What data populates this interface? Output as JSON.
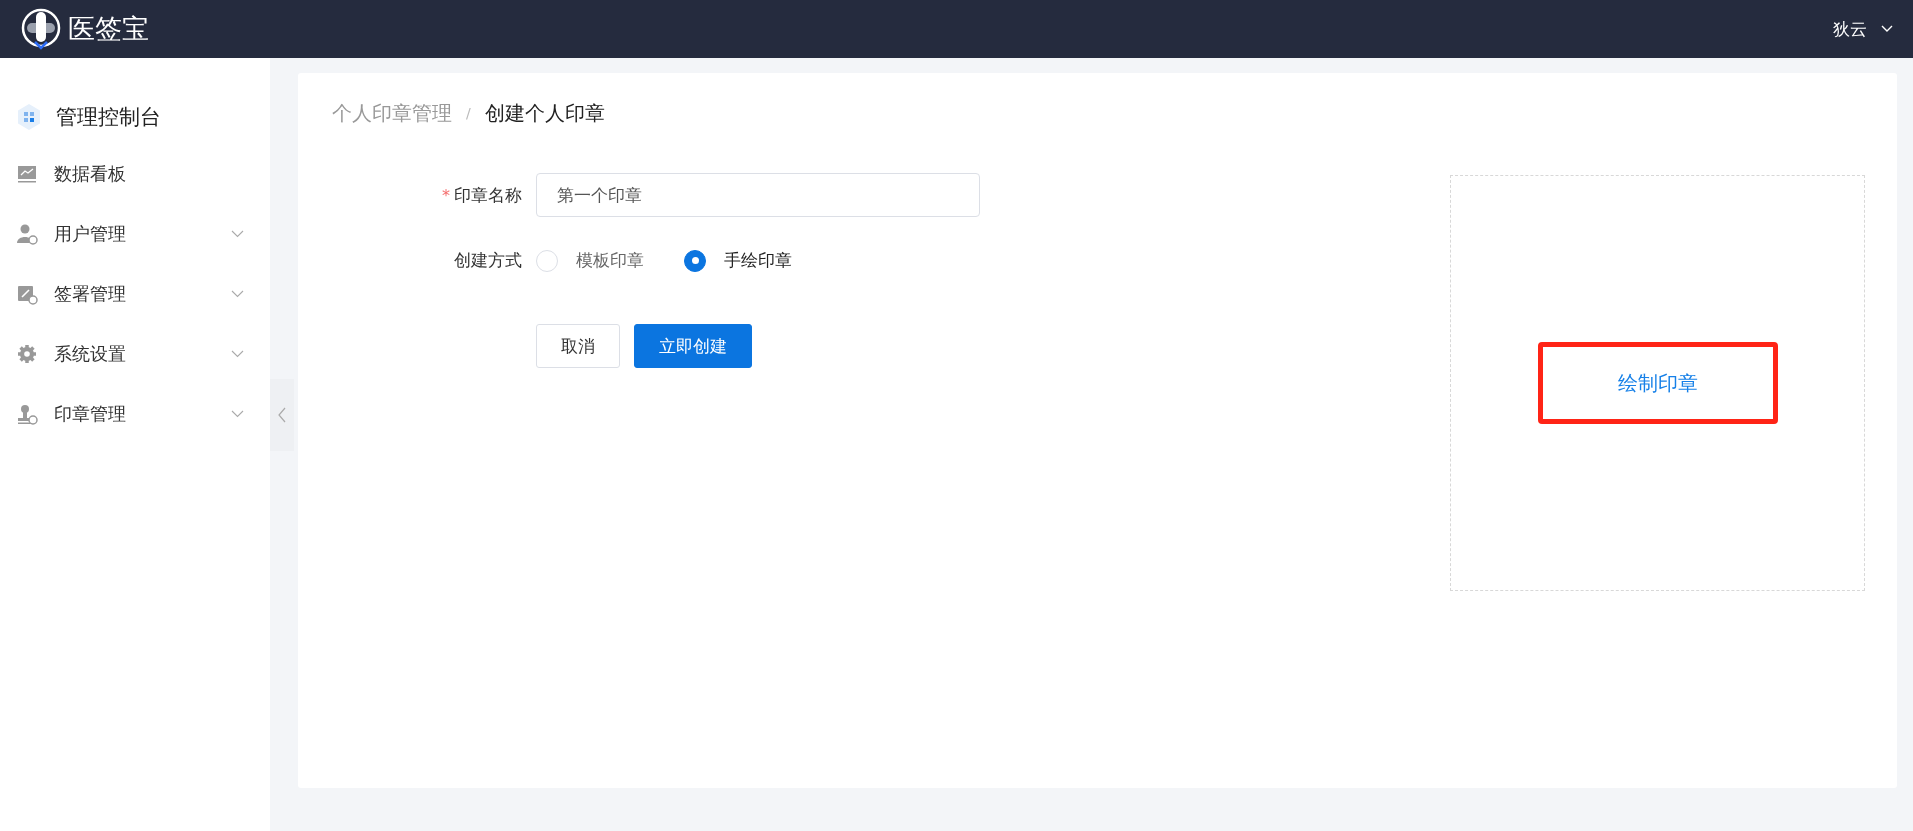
{
  "header": {
    "logo_text": "医签宝",
    "user": "狄云"
  },
  "sidebar": {
    "title": "管理控制台",
    "items": [
      {
        "label": "数据看板",
        "has_submenu": false
      },
      {
        "label": "用户管理",
        "has_submenu": true
      },
      {
        "label": "签署管理",
        "has_submenu": true
      },
      {
        "label": "系统设置",
        "has_submenu": true
      },
      {
        "label": "印章管理",
        "has_submenu": true
      }
    ]
  },
  "breadcrumb": {
    "separator": "/",
    "items": [
      {
        "label": "个人印章管理",
        "current": false
      },
      {
        "label": "创建个人印章",
        "current": true
      }
    ]
  },
  "form": {
    "name_field": {
      "label": "印章名称",
      "required_mark": "*",
      "value": "第一个印章"
    },
    "method": {
      "label": "创建方式",
      "options": [
        {
          "label": "模板印章",
          "selected": false
        },
        {
          "label": "手绘印章",
          "selected": true
        }
      ]
    },
    "buttons": [
      {
        "label": "取消",
        "kind": "default"
      },
      {
        "label": "立即创建",
        "kind": "primary"
      }
    ]
  },
  "preview": {
    "draw_link": {
      "label": "绘制印章",
      "highlighted": true
    }
  }
}
